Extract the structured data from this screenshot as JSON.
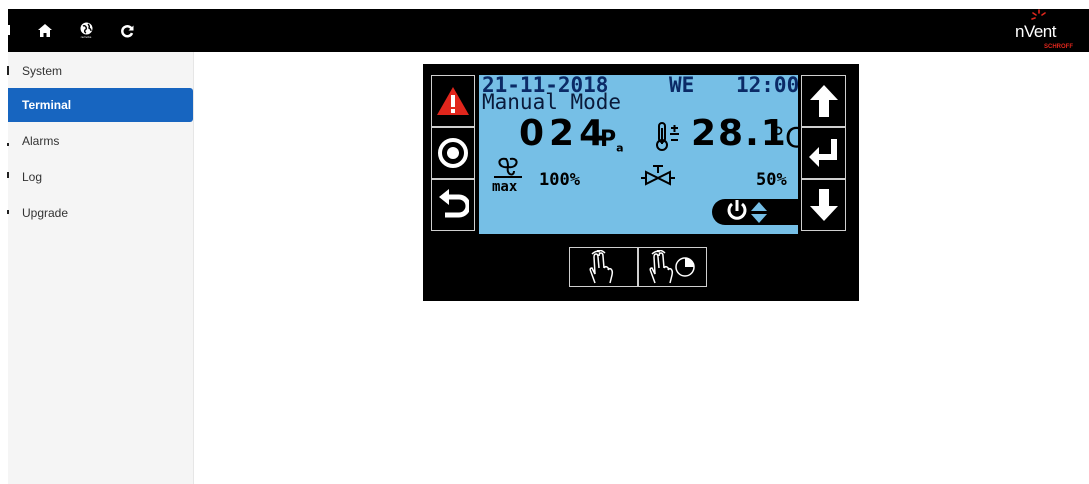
{
  "topbar": {
    "home_icon": "home-icon",
    "remote_icon": "remote-globe-icon",
    "remote_sub": "remote",
    "refresh_icon": "refresh-icon",
    "logo_text": "nVent",
    "logo_sub": "SCHROFF"
  },
  "sidebar": {
    "items": [
      {
        "label": "System",
        "active": false
      },
      {
        "label": "Terminal",
        "active": true
      },
      {
        "label": "Alarms",
        "active": false
      },
      {
        "label": "Log",
        "active": false
      },
      {
        "label": "Upgrade",
        "active": false
      }
    ],
    "active_color": "#1765c0"
  },
  "terminal": {
    "lcd_color": "#76bfe6",
    "date": "21-11-2018",
    "weekday": "WE",
    "time": "12:00",
    "mode": "Manual Mode",
    "pressure_value": "024",
    "pressure_unit": "P",
    "pressure_unit_sub": "a",
    "temperature_value": "28.1",
    "temperature_unit": "°C",
    "fan_label": "max",
    "fan_percent": "100%",
    "valve_percent": "50%",
    "left_buttons": [
      "alarm-warning-icon",
      "record-icon",
      "back-icon"
    ],
    "right_buttons": [
      "arrow-up-icon",
      "enter-icon",
      "arrow-down-icon"
    ],
    "gesture_buttons": [
      "two-finger-tap-icon",
      "two-finger-tap-timer-icon"
    ]
  }
}
